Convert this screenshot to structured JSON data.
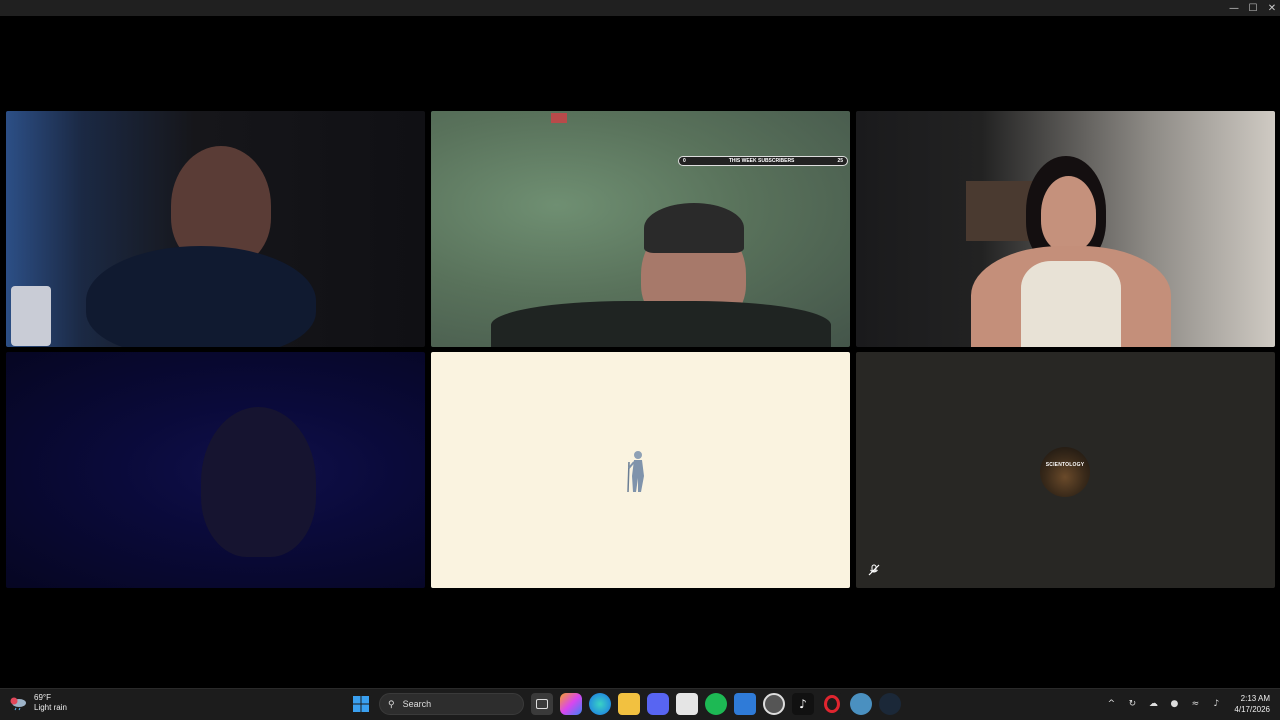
{
  "window": {
    "minimize": "—",
    "maximize": "☐",
    "close": "✕"
  },
  "tiles": [
    {
      "name": "participant-1"
    },
    {
      "name": "participant-2",
      "overlay": {
        "left": "0",
        "label": "THIS WEEK SUBSCRIBERS",
        "right": "25"
      }
    },
    {
      "name": "participant-3"
    },
    {
      "name": "participant-4"
    },
    {
      "name": "participant-5"
    },
    {
      "name": "participant-6",
      "badge": "SCIENTOLOGY"
    }
  ],
  "taskbar": {
    "weather": {
      "temp": "69°F",
      "condition": "Light rain"
    },
    "search_placeholder": "Search",
    "clock": {
      "time": "2:13 AM",
      "date": "4/17/2026"
    },
    "tray_arrow": "^"
  }
}
